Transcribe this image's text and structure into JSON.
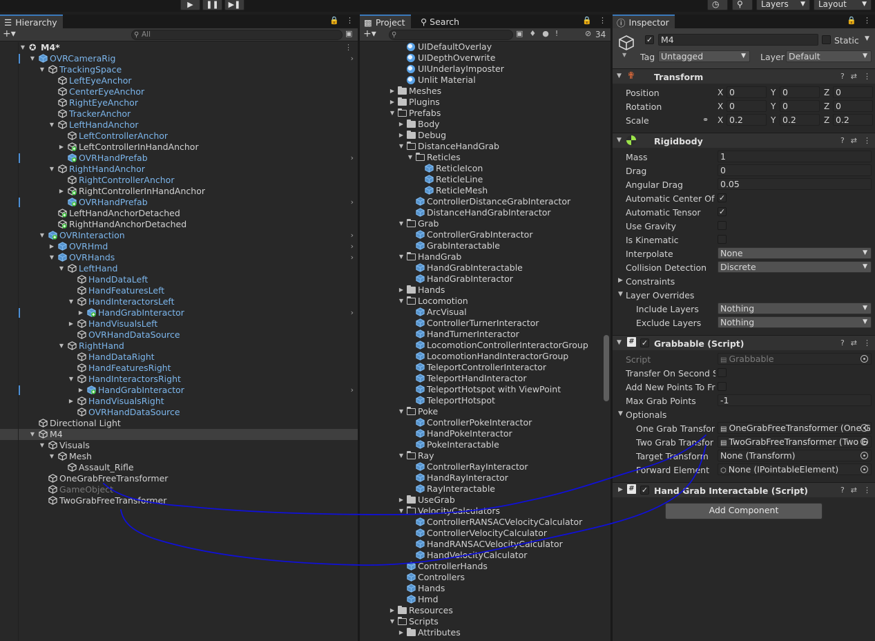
{
  "toolbar": {
    "play_icon": "play-icon",
    "pause_icon": "pause-icon",
    "step_icon": "step-icon",
    "history_icon": "history-icon",
    "search_icon": "search-icon",
    "layers_label": "Layers",
    "layout_label": "Layout"
  },
  "hierarchy": {
    "tab_label": "Hierarchy",
    "search_placeholder": "All",
    "scene_name": "M4*",
    "rows": [
      {
        "label": "OVRCameraRig",
        "indent": 1,
        "arrow": "open",
        "icon": "prefab",
        "color": "blue",
        "bar": true,
        "chev": true
      },
      {
        "label": "TrackingSpace",
        "indent": 2,
        "arrow": "open",
        "icon": "cube",
        "color": "blue"
      },
      {
        "label": "LeftEyeAnchor",
        "indent": 3,
        "arrow": "",
        "icon": "cube",
        "color": "blue"
      },
      {
        "label": "CenterEyeAnchor",
        "indent": 3,
        "arrow": "",
        "icon": "cube",
        "color": "blue"
      },
      {
        "label": "RightEyeAnchor",
        "indent": 3,
        "arrow": "",
        "icon": "cube",
        "color": "blue"
      },
      {
        "label": "TrackerAnchor",
        "indent": 3,
        "arrow": "",
        "icon": "cube",
        "color": "blue"
      },
      {
        "label": "LeftHandAnchor",
        "indent": 3,
        "arrow": "open",
        "icon": "cube",
        "color": "blue"
      },
      {
        "label": "LeftControllerAnchor",
        "indent": 4,
        "arrow": "",
        "icon": "cube",
        "color": "blue"
      },
      {
        "label": "LeftControllerInHandAnchor",
        "indent": 4,
        "arrow": "closed",
        "icon": "cube-added",
        "color": "white"
      },
      {
        "label": "OVRHandPrefab",
        "indent": 4,
        "arrow": "",
        "icon": "prefab-added",
        "color": "blue",
        "bar": true,
        "chev": true
      },
      {
        "label": "RightHandAnchor",
        "indent": 3,
        "arrow": "open",
        "icon": "cube",
        "color": "blue"
      },
      {
        "label": "RightControllerAnchor",
        "indent": 4,
        "arrow": "",
        "icon": "cube",
        "color": "blue"
      },
      {
        "label": "RightControllerInHandAnchor",
        "indent": 4,
        "arrow": "closed",
        "icon": "cube-added",
        "color": "white"
      },
      {
        "label": "OVRHandPrefab",
        "indent": 4,
        "arrow": "",
        "icon": "prefab-added",
        "color": "blue",
        "bar": true,
        "chev": true
      },
      {
        "label": "LeftHandAnchorDetached",
        "indent": 3,
        "arrow": "",
        "icon": "cube-added",
        "color": "white"
      },
      {
        "label": "RightHandAnchorDetached",
        "indent": 3,
        "arrow": "",
        "icon": "cube-added",
        "color": "white"
      },
      {
        "label": "OVRInteraction",
        "indent": 2,
        "arrow": "open",
        "icon": "prefab-added",
        "color": "blue",
        "chev": true
      },
      {
        "label": "OVRHmd",
        "indent": 3,
        "arrow": "closed",
        "icon": "prefab-variant",
        "color": "blue",
        "chev": true
      },
      {
        "label": "OVRHands",
        "indent": 3,
        "arrow": "open",
        "icon": "prefab-variant",
        "color": "blue",
        "chev": true
      },
      {
        "label": "LeftHand",
        "indent": 4,
        "arrow": "open",
        "icon": "cube",
        "color": "blue"
      },
      {
        "label": "HandDataLeft",
        "indent": 5,
        "arrow": "",
        "icon": "cube",
        "color": "blue"
      },
      {
        "label": "HandFeaturesLeft",
        "indent": 5,
        "arrow": "",
        "icon": "cube",
        "color": "blue"
      },
      {
        "label": "HandInteractorsLeft",
        "indent": 5,
        "arrow": "open",
        "icon": "cube",
        "color": "blue"
      },
      {
        "label": "HandGrabInteractor",
        "indent": 6,
        "arrow": "closed",
        "icon": "prefab-added",
        "color": "blue",
        "bar": true,
        "chev": true
      },
      {
        "label": "HandVisualsLeft",
        "indent": 5,
        "arrow": "closed",
        "icon": "cube",
        "color": "blue"
      },
      {
        "label": "OVRHandDataSource",
        "indent": 5,
        "arrow": "",
        "icon": "cube",
        "color": "blue"
      },
      {
        "label": "RightHand",
        "indent": 4,
        "arrow": "open",
        "icon": "cube",
        "color": "blue"
      },
      {
        "label": "HandDataRight",
        "indent": 5,
        "arrow": "",
        "icon": "cube",
        "color": "blue"
      },
      {
        "label": "HandFeaturesRight",
        "indent": 5,
        "arrow": "",
        "icon": "cube",
        "color": "blue"
      },
      {
        "label": "HandInteractorsRight",
        "indent": 5,
        "arrow": "open",
        "icon": "cube",
        "color": "blue"
      },
      {
        "label": "HandGrabInteractor",
        "indent": 6,
        "arrow": "closed",
        "icon": "prefab-added",
        "color": "blue",
        "bar": true,
        "chev": true
      },
      {
        "label": "HandVisualsRight",
        "indent": 5,
        "arrow": "closed",
        "icon": "cube",
        "color": "blue"
      },
      {
        "label": "OVRHandDataSource",
        "indent": 5,
        "arrow": "",
        "icon": "cube",
        "color": "blue"
      },
      {
        "label": "Directional Light",
        "indent": 1,
        "arrow": "",
        "icon": "cube",
        "color": "white"
      },
      {
        "label": "M4",
        "indent": 1,
        "arrow": "open",
        "icon": "cube",
        "color": "white",
        "selected": true
      },
      {
        "label": "Visuals",
        "indent": 2,
        "arrow": "open",
        "icon": "cube",
        "color": "white"
      },
      {
        "label": "Mesh",
        "indent": 3,
        "arrow": "open",
        "icon": "cube",
        "color": "white"
      },
      {
        "label": "Assault_Rifle",
        "indent": 4,
        "arrow": "",
        "icon": "cube",
        "color": "white"
      },
      {
        "label": "OneGrabFreeTransformer",
        "indent": 2,
        "arrow": "",
        "icon": "cube",
        "color": "white"
      },
      {
        "label": "GameObject",
        "indent": 2,
        "arrow": "",
        "icon": "cube",
        "color": "grey"
      },
      {
        "label": "TwoGrabFreeTransformer",
        "indent": 2,
        "arrow": "",
        "icon": "cube",
        "color": "white"
      }
    ]
  },
  "project": {
    "tab_label": "Project",
    "search_tab_label": "Search",
    "hidden_count": "34",
    "rows": [
      {
        "label": "UIDefaultOverlay",
        "indent": 3,
        "arrow": "",
        "icon": "material"
      },
      {
        "label": "UIDepthOverwrite",
        "indent": 3,
        "arrow": "",
        "icon": "material"
      },
      {
        "label": "UIUnderlayImposter",
        "indent": 3,
        "arrow": "",
        "icon": "material"
      },
      {
        "label": "Unlit Material",
        "indent": 3,
        "arrow": "",
        "icon": "material"
      },
      {
        "label": "Meshes",
        "indent": 2,
        "arrow": "closed",
        "icon": "folder"
      },
      {
        "label": "Plugins",
        "indent": 2,
        "arrow": "closed",
        "icon": "folder"
      },
      {
        "label": "Prefabs",
        "indent": 2,
        "arrow": "open",
        "icon": "folder-open"
      },
      {
        "label": "Body",
        "indent": 3,
        "arrow": "closed",
        "icon": "folder"
      },
      {
        "label": "Debug",
        "indent": 3,
        "arrow": "closed",
        "icon": "folder"
      },
      {
        "label": "DistanceHandGrab",
        "indent": 3,
        "arrow": "open",
        "icon": "folder-open"
      },
      {
        "label": "Reticles",
        "indent": 4,
        "arrow": "open",
        "icon": "folder-open"
      },
      {
        "label": "ReticleIcon",
        "indent": 5,
        "arrow": "",
        "icon": "prefab"
      },
      {
        "label": "ReticleLine",
        "indent": 5,
        "arrow": "",
        "icon": "prefab"
      },
      {
        "label": "ReticleMesh",
        "indent": 5,
        "arrow": "",
        "icon": "prefab"
      },
      {
        "label": "ControllerDistanceGrabInteractor",
        "indent": 4,
        "arrow": "",
        "icon": "prefab"
      },
      {
        "label": "DistanceHandGrabInteractor",
        "indent": 4,
        "arrow": "",
        "icon": "prefab"
      },
      {
        "label": "Grab",
        "indent": 3,
        "arrow": "open",
        "icon": "folder-open"
      },
      {
        "label": "ControllerGrabInteractor",
        "indent": 4,
        "arrow": "",
        "icon": "prefab"
      },
      {
        "label": "GrabInteractable",
        "indent": 4,
        "arrow": "",
        "icon": "prefab"
      },
      {
        "label": "HandGrab",
        "indent": 3,
        "arrow": "open",
        "icon": "folder-open"
      },
      {
        "label": "HandGrabInteractable",
        "indent": 4,
        "arrow": "",
        "icon": "prefab"
      },
      {
        "label": "HandGrabInteractor",
        "indent": 4,
        "arrow": "",
        "icon": "prefab"
      },
      {
        "label": "Hands",
        "indent": 3,
        "arrow": "closed",
        "icon": "folder"
      },
      {
        "label": "Locomotion",
        "indent": 3,
        "arrow": "open",
        "icon": "folder-open"
      },
      {
        "label": "ArcVisual",
        "indent": 4,
        "arrow": "",
        "icon": "prefab"
      },
      {
        "label": "ControllerTurnerInteractor",
        "indent": 4,
        "arrow": "",
        "icon": "prefab"
      },
      {
        "label": "HandTurnerInteractor",
        "indent": 4,
        "arrow": "",
        "icon": "prefab"
      },
      {
        "label": "LocomotionControllerInteractorGroup",
        "indent": 4,
        "arrow": "",
        "icon": "prefab"
      },
      {
        "label": "LocomotionHandInteractorGroup",
        "indent": 4,
        "arrow": "",
        "icon": "prefab"
      },
      {
        "label": "TeleportControllerInteractor",
        "indent": 4,
        "arrow": "",
        "icon": "prefab"
      },
      {
        "label": "TeleportHandInteractor",
        "indent": 4,
        "arrow": "",
        "icon": "prefab"
      },
      {
        "label": "TeleportHotspot with ViewPoint",
        "indent": 4,
        "arrow": "",
        "icon": "prefab-variant"
      },
      {
        "label": "TeleportHotspot",
        "indent": 4,
        "arrow": "",
        "icon": "prefab"
      },
      {
        "label": "Poke",
        "indent": 3,
        "arrow": "open",
        "icon": "folder-open"
      },
      {
        "label": "ControllerPokeInteractor",
        "indent": 4,
        "arrow": "",
        "icon": "prefab"
      },
      {
        "label": "HandPokeInteractor",
        "indent": 4,
        "arrow": "",
        "icon": "prefab"
      },
      {
        "label": "PokeInteractable",
        "indent": 4,
        "arrow": "",
        "icon": "prefab"
      },
      {
        "label": "Ray",
        "indent": 3,
        "arrow": "open",
        "icon": "folder-open"
      },
      {
        "label": "ControllerRayInteractor",
        "indent": 4,
        "arrow": "",
        "icon": "prefab"
      },
      {
        "label": "HandRayInteractor",
        "indent": 4,
        "arrow": "",
        "icon": "prefab"
      },
      {
        "label": "RayInteractable",
        "indent": 4,
        "arrow": "",
        "icon": "prefab"
      },
      {
        "label": "UseGrab",
        "indent": 3,
        "arrow": "closed",
        "icon": "folder"
      },
      {
        "label": "VelocityCalculators",
        "indent": 3,
        "arrow": "open",
        "icon": "folder-open"
      },
      {
        "label": "ControllerRANSACVelocityCalculator",
        "indent": 4,
        "arrow": "",
        "icon": "prefab"
      },
      {
        "label": "ControllerVelocityCalculator",
        "indent": 4,
        "arrow": "",
        "icon": "prefab"
      },
      {
        "label": "HandRANSACVelocityCalculator",
        "indent": 4,
        "arrow": "",
        "icon": "prefab"
      },
      {
        "label": "HandVelocityCalculator",
        "indent": 4,
        "arrow": "",
        "icon": "prefab"
      },
      {
        "label": "ControllerHands",
        "indent": 3,
        "arrow": "",
        "icon": "prefab"
      },
      {
        "label": "Controllers",
        "indent": 3,
        "arrow": "",
        "icon": "prefab"
      },
      {
        "label": "Hands",
        "indent": 3,
        "arrow": "",
        "icon": "prefab"
      },
      {
        "label": "Hmd",
        "indent": 3,
        "arrow": "",
        "icon": "prefab"
      },
      {
        "label": "Resources",
        "indent": 2,
        "arrow": "closed",
        "icon": "folder"
      },
      {
        "label": "Scripts",
        "indent": 2,
        "arrow": "open",
        "icon": "folder-open"
      },
      {
        "label": "Attributes",
        "indent": 3,
        "arrow": "closed",
        "icon": "folder"
      }
    ]
  },
  "inspector": {
    "tab_label": "Inspector",
    "object_name": "M4",
    "static_label": "Static",
    "tag_label": "Tag",
    "tag_value": "Untagged",
    "layer_label": "Layer",
    "layer_value": "Default",
    "transform": {
      "title": "Transform",
      "position_label": "Position",
      "rotation_label": "Rotation",
      "scale_label": "Scale",
      "position": [
        "0",
        "0",
        "0"
      ],
      "rotation": [
        "0",
        "0",
        "0"
      ],
      "scale": [
        "0.2",
        "0.2",
        "0.2"
      ],
      "axes": [
        "X",
        "Y",
        "Z"
      ]
    },
    "rigidbody": {
      "title": "Rigidbody",
      "mass_label": "Mass",
      "mass": "1",
      "drag_label": "Drag",
      "drag": "0",
      "angular_drag_label": "Angular Drag",
      "angular_drag": "0.05",
      "auto_com_label": "Automatic Center Of Ma",
      "auto_tensor_label": "Automatic Tensor",
      "use_gravity_label": "Use Gravity",
      "is_kinematic_label": "Is Kinematic",
      "interpolate_label": "Interpolate",
      "interpolate": "None",
      "collision_label": "Collision Detection",
      "collision": "Discrete",
      "constraints_label": "Constraints",
      "layer_overrides_label": "Layer Overrides",
      "include_label": "Include Layers",
      "include": "Nothing",
      "exclude_label": "Exclude Layers",
      "exclude": "Nothing"
    },
    "grabbable": {
      "title": "Grabbable (Script)",
      "script_label": "Script",
      "script": "Grabbable",
      "transfer_label": "Transfer On Second Se",
      "add_points_label": "Add New Points To Fro",
      "max_points_label": "Max Grab Points",
      "max_points": "-1",
      "optionals_label": "Optionals",
      "one_grab_label": "One Grab Transform",
      "one_grab_value": "OneGrabFreeTransformer (One Gr",
      "two_grab_label": "Two Grab Transfor",
      "two_grab_value": "TwoGrabFreeTransformer (Two G",
      "target_label": "Target Transform",
      "target_value": "None (Transform)",
      "forward_label": "Forward Element",
      "forward_value": "None (IPointableElement)"
    },
    "hand_grab": {
      "title": "Hand Grab Interactable (Script)"
    },
    "add_component_label": "Add Component"
  },
  "annotation": {
    "stroke_color": "#1010d8"
  }
}
